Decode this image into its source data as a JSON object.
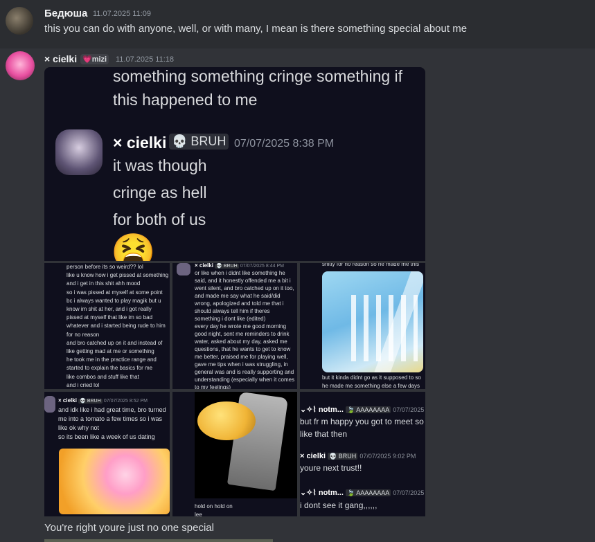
{
  "messages": [
    {
      "author": "Бедюша",
      "timestamp": "11.07.2025 11:09",
      "text": "this you can do with anyone, well, or with many, I mean is there something special about me"
    },
    {
      "author": "× cielki",
      "tag": "💗mizi",
      "timestamp": "11.07.2025 11:18",
      "quoted": {
        "line1": "something something cringe something if",
        "line2": "this happened to me",
        "author": "× cielki",
        "tag": "💀 BRUH",
        "timestamp": "07/07/2025 8:38 PM",
        "lines": [
          "it was though",
          "cringe as hell",
          "for both of us"
        ],
        "emoji": "😫"
      }
    },
    {
      "text": "You're right youre just no one special"
    }
  ],
  "tiles": {
    "t1": {
      "lines": [
        "person before its so weird?? lol",
        "like u know how i get pissed at something",
        "and i get in this shit ahh mood",
        "so i was pissed at myself at some point",
        "bc i always wanted to play magik but u",
        "know im shit at her, and i got really",
        "pissed at myself that like im so bad",
        "whatever and i started being rude to him",
        "for no reason",
        "and bro catched up on it and instead of",
        "like getting mad at me or something",
        "he took me in the practice range and",
        "started to explain the basics for me",
        "like combos and stuff like that",
        "and i cried lol"
      ]
    },
    "t2": {
      "header_author": "× cielki",
      "header_tag": "💀 BRUH",
      "header_ts": "07/07/2025 8:44 PM",
      "lines": [
        "or like when i didnt like something he",
        "said, and it honestly offended me a bit i",
        "went silent, and bro catched up on it too,",
        "and made me say what he said/did",
        "wrong, apologized and told me that i",
        "should always tell him if theres",
        "something i dont like (edited)",
        "every day he wrote me good morning",
        "good night, sent me reminders to drink",
        "water, asked about my day, asked me",
        "questions, that he wants to get to know",
        "me better, praised me for playing well,",
        "gave me tips when i was struggling, in",
        "general was and is really supporting and",
        "understanding (especially when it comes",
        "to my feelings)"
      ]
    },
    "t3": {
      "top": "shitty for no reason so he made me this",
      "bottom1": "but it kinda didnt go as it supposed to so",
      "bottom2": "he made me something else a few days"
    },
    "t4": {
      "author": "× cielki",
      "tag": "💀 BRUH",
      "ts": "07/07/2025 8:52 PM",
      "lines": [
        "and idk like i had great time, bro turned",
        "me into a tomato a few times so i was",
        "like ok why not",
        "so its been like a week of us dating"
      ]
    },
    "t5": {
      "caption1": "hold on hold on",
      "caption2": "lee"
    },
    "t6": {
      "a1": "⌄✧⌇ notm...",
      "tag1": "🍃 AAAAAAAA",
      "ts1": "07/07/2025",
      "line1": "but fr m happy you got to meet so",
      "line2": "like that then",
      "a2": "× cielki",
      "tag2": "💀 BRUH",
      "ts2": "07/07/2025 9:02 PM",
      "line3": "youre next trust!!",
      "a3": "⌄✧⌇ notm...",
      "tag3": "🍃 AAAAAAAA",
      "ts3": "07/07/2025",
      "line4": "i dont see it gang,,,,,,"
    }
  },
  "colors": {
    "background": "#313338",
    "highlight_row": "#2b2d31",
    "tile_bg": "#0f0f1d"
  }
}
